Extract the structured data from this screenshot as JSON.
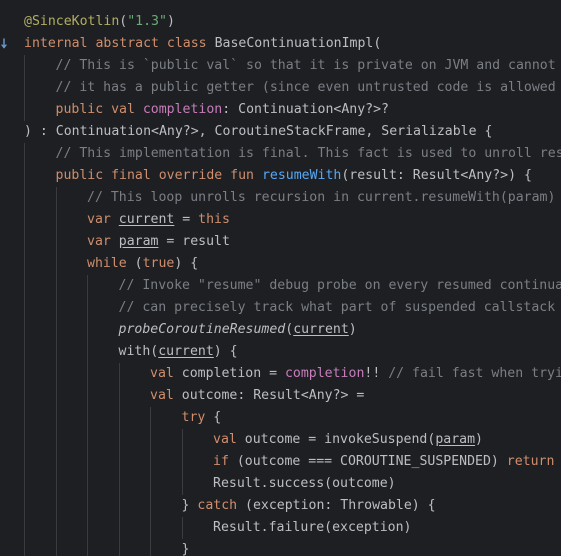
{
  "editor": {
    "lines": [
      {
        "indent": 0,
        "tokens": [
          {
            "t": "@SinceKotlin",
            "c": "ann"
          },
          {
            "t": "(",
            "c": ""
          },
          {
            "t": "\"1.3\"",
            "c": "str"
          },
          {
            "t": ")",
            "c": ""
          }
        ]
      },
      {
        "indent": 0,
        "tokens": [
          {
            "t": "internal abstract class ",
            "c": "kw"
          },
          {
            "t": "BaseContinuationImpl(",
            "c": ""
          }
        ]
      },
      {
        "indent": 1,
        "tokens": [
          {
            "t": "// This is `public val` so that it is private on JVM and cannot be",
            "c": "cmt"
          }
        ]
      },
      {
        "indent": 1,
        "tokens": [
          {
            "t": "// it has a public getter (since even untrusted code is allowed to",
            "c": "cmt"
          }
        ]
      },
      {
        "indent": 1,
        "tokens": [
          {
            "t": "public val ",
            "c": "kw"
          },
          {
            "t": "completion",
            "c": "prop"
          },
          {
            "t": ": Continuation<Any?>?",
            "c": ""
          }
        ]
      },
      {
        "indent": 0,
        "tokens": [
          {
            "t": ") : Continuation<Any?>, CoroutineStackFrame, Serializable {",
            "c": ""
          }
        ]
      },
      {
        "indent": 1,
        "tokens": [
          {
            "t": "// This implementation is final. This fact is used to unroll resum",
            "c": "cmt"
          }
        ]
      },
      {
        "indent": 1,
        "tokens": [
          {
            "t": "public final override fun ",
            "c": "kw"
          },
          {
            "t": "resumeWith",
            "c": "fn"
          },
          {
            "t": "(result: Result<Any?>) {",
            "c": ""
          }
        ]
      },
      {
        "indent": 2,
        "tokens": [
          {
            "t": "// This loop unrolls recursion in current.resumeWith(param) to",
            "c": "cmt"
          }
        ]
      },
      {
        "indent": 2,
        "tokens": [
          {
            "t": "var ",
            "c": "kw"
          },
          {
            "t": "current",
            "c": "ul"
          },
          {
            "t": " = ",
            "c": ""
          },
          {
            "t": "this",
            "c": "kw"
          }
        ]
      },
      {
        "indent": 2,
        "tokens": [
          {
            "t": "var ",
            "c": "kw"
          },
          {
            "t": "param",
            "c": "ul"
          },
          {
            "t": " = result",
            "c": ""
          }
        ]
      },
      {
        "indent": 2,
        "tokens": [
          {
            "t": "while ",
            "c": "kw"
          },
          {
            "t": "(",
            "c": ""
          },
          {
            "t": "true",
            "c": "kw"
          },
          {
            "t": ") {",
            "c": ""
          }
        ]
      },
      {
        "indent": 3,
        "tokens": [
          {
            "t": "// Invoke \"resume\" debug probe on every resumed continuation",
            "c": "cmt"
          }
        ]
      },
      {
        "indent": 3,
        "tokens": [
          {
            "t": "// can precisely track what part of suspended callstack was",
            "c": "cmt"
          }
        ]
      },
      {
        "indent": 3,
        "tokens": [
          {
            "t": "probeCoroutineResumed",
            "c": "it"
          },
          {
            "t": "(",
            "c": ""
          },
          {
            "t": "current",
            "c": "ul"
          },
          {
            "t": ")",
            "c": ""
          }
        ]
      },
      {
        "indent": 3,
        "tokens": [
          {
            "t": "with(",
            "c": ""
          },
          {
            "t": "current",
            "c": "ul"
          },
          {
            "t": ") {",
            "c": ""
          }
        ]
      },
      {
        "indent": 4,
        "tokens": [
          {
            "t": "val ",
            "c": "kw"
          },
          {
            "t": "completion = ",
            "c": ""
          },
          {
            "t": "completion",
            "c": "prop"
          },
          {
            "t": "!! ",
            "c": ""
          },
          {
            "t": "// fail fast when trying",
            "c": "cmt"
          }
        ]
      },
      {
        "indent": 4,
        "tokens": [
          {
            "t": "val ",
            "c": "kw"
          },
          {
            "t": "outcome: Result<Any?> =",
            "c": ""
          }
        ]
      },
      {
        "indent": 5,
        "tokens": [
          {
            "t": "try ",
            "c": "kw"
          },
          {
            "t": "{",
            "c": ""
          }
        ]
      },
      {
        "indent": 6,
        "tokens": [
          {
            "t": "val ",
            "c": "kw"
          },
          {
            "t": "outcome = invokeSuspend(",
            "c": ""
          },
          {
            "t": "param",
            "c": "ul"
          },
          {
            "t": ")",
            "c": ""
          }
        ]
      },
      {
        "indent": 6,
        "tokens": [
          {
            "t": "if ",
            "c": "kw"
          },
          {
            "t": "(outcome === COROUTINE_SUSPENDED) ",
            "c": ""
          },
          {
            "t": "return",
            "c": "kw"
          }
        ]
      },
      {
        "indent": 6,
        "tokens": [
          {
            "t": "Result.success(outcome)",
            "c": ""
          }
        ]
      },
      {
        "indent": 5,
        "tokens": [
          {
            "t": "} ",
            "c": ""
          },
          {
            "t": "catch ",
            "c": "kw"
          },
          {
            "t": "(exception: Throwable) {",
            "c": ""
          }
        ]
      },
      {
        "indent": 6,
        "tokens": [
          {
            "t": "Result.failure(exception)",
            "c": ""
          }
        ]
      },
      {
        "indent": 5,
        "tokens": [
          {
            "t": "}",
            "c": ""
          }
        ]
      }
    ]
  }
}
